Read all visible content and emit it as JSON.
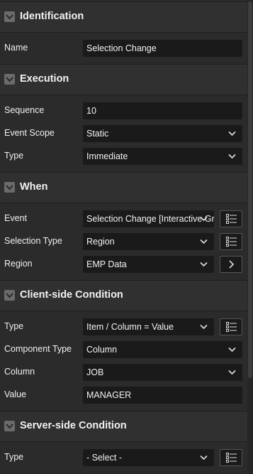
{
  "sections": {
    "identification": {
      "title": "Identification",
      "name_label": "Name",
      "name_value": "Selection Change"
    },
    "execution": {
      "title": "Execution",
      "sequence_label": "Sequence",
      "sequence_value": "10",
      "scope_label": "Event Scope",
      "scope_value": "Static",
      "type_label": "Type",
      "type_value": "Immediate"
    },
    "when": {
      "title": "When",
      "event_label": "Event",
      "event_value": "Selection Change [Interactive Grid]",
      "selection_type_label": "Selection Type",
      "selection_type_value": "Region",
      "region_label": "Region",
      "region_value": "EMP Data"
    },
    "client_condition": {
      "title": "Client-side Condition",
      "type_label": "Type",
      "type_value": "Item / Column = Value",
      "component_type_label": "Component Type",
      "component_type_value": "Column",
      "column_label": "Column",
      "column_value": "JOB",
      "value_label": "Value",
      "value_value": "MANAGER"
    },
    "server_condition": {
      "title": "Server-side Condition",
      "type_label": "Type",
      "type_value": "- Select -"
    }
  },
  "icons": {
    "toggle": "chevron-down-icon",
    "select": "chevron-down-icon",
    "list": "list-icon",
    "go": "chevron-right-icon"
  },
  "colors": {
    "background": "#2b2b2b",
    "header": "#303030",
    "field": "#1a1a1a",
    "text": "#f2f2f2"
  }
}
